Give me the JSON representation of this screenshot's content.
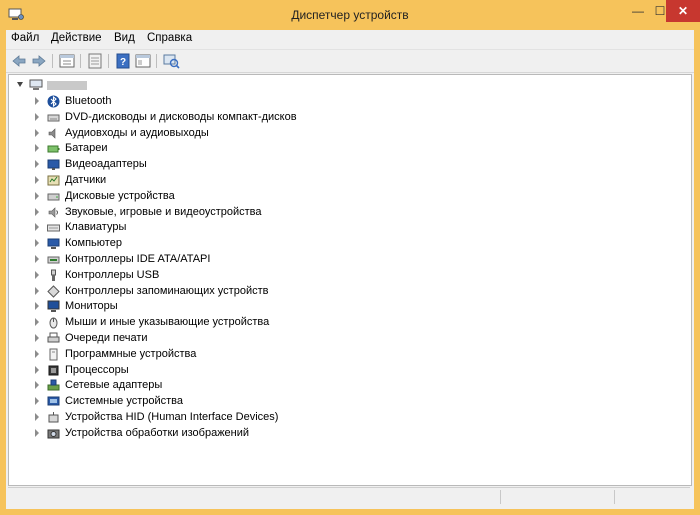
{
  "window": {
    "title": "Диспетчер устройств",
    "minimize_glyph": "—",
    "maximize_glyph": "☐",
    "close_glyph": "✕"
  },
  "menu": [
    "Файл",
    "Действие",
    "Вид",
    "Справка"
  ],
  "toolbar": {
    "buttons": [
      "back-icon",
      "forward-icon",
      "properties-icon",
      "show-hidden-icon",
      "help-icon",
      "view-icon",
      "scan-hardware-icon"
    ]
  },
  "tree": {
    "root_icon": "computer-icon",
    "categories": [
      {
        "label": "Bluetooth",
        "icon": "bluetooth-icon"
      },
      {
        "label": "DVD-дисководы и дисководы компакт-дисков",
        "icon": "dvd-drive-icon"
      },
      {
        "label": "Аудиовходы и аудиовыходы",
        "icon": "audio-io-icon"
      },
      {
        "label": "Батареи",
        "icon": "battery-icon"
      },
      {
        "label": "Видеоадаптеры",
        "icon": "display-adapter-icon"
      },
      {
        "label": "Датчики",
        "icon": "sensor-icon"
      },
      {
        "label": "Дисковые устройства",
        "icon": "disk-drive-icon"
      },
      {
        "label": "Звуковые, игровые и видеоустройства",
        "icon": "sound-icon"
      },
      {
        "label": "Клавиатуры",
        "icon": "keyboard-icon"
      },
      {
        "label": "Компьютер",
        "icon": "computer-icon"
      },
      {
        "label": "Контроллеры IDE ATA/ATAPI",
        "icon": "ide-controller-icon"
      },
      {
        "label": "Контроллеры USB",
        "icon": "usb-icon"
      },
      {
        "label": "Контроллеры запоминающих устройств",
        "icon": "storage-controller-icon"
      },
      {
        "label": "Мониторы",
        "icon": "monitor-icon"
      },
      {
        "label": "Мыши и иные указывающие устройства",
        "icon": "mouse-icon"
      },
      {
        "label": "Очереди печати",
        "icon": "printer-icon"
      },
      {
        "label": "Программные устройства",
        "icon": "software-device-icon"
      },
      {
        "label": "Процессоры",
        "icon": "processor-icon"
      },
      {
        "label": "Сетевые адаптеры",
        "icon": "network-adapter-icon"
      },
      {
        "label": "Системные устройства",
        "icon": "system-device-icon"
      },
      {
        "label": "Устройства HID (Human Interface Devices)",
        "icon": "hid-icon"
      },
      {
        "label": "Устройства обработки изображений",
        "icon": "imaging-device-icon"
      }
    ]
  }
}
